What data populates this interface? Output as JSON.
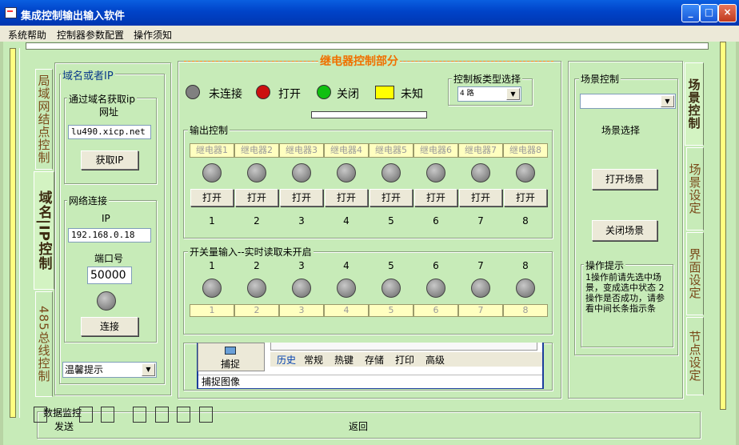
{
  "window": {
    "title": "集成控制输出输入软件",
    "min_label": "_",
    "max_label": "□",
    "close_label": "×"
  },
  "menu": [
    "系统帮助",
    "控制器参数配置",
    "操作须知"
  ],
  "left_tabs": [
    "局域网结点控制",
    "域名|IP控制",
    "485总线控制"
  ],
  "right_tabs": [
    "场景控制",
    "场景设定",
    "界面设定",
    "节点设定"
  ],
  "domain_panel": {
    "title": "域名或者IP",
    "domain_group": "通过域名获取ip",
    "url_label": "网址",
    "url_value": "lu490.xicp.net",
    "get_ip_button": "获取IP",
    "network_group": "网络连接",
    "ip_label": "IP",
    "ip_value": "192.168.0.18",
    "port_label": "端口号",
    "port_value": "50000",
    "connect_button": "连接",
    "hint_combo": "温馨提示"
  },
  "relay": {
    "title": "继电器控制部分",
    "status_legend": [
      {
        "label": "未连接",
        "color": "#808080"
      },
      {
        "label": "打开",
        "color": "#cc1010"
      },
      {
        "label": "关闭",
        "color": "#10c010"
      },
      {
        "label": "未知",
        "color": "#ffff00"
      }
    ],
    "board_type_label": "控制板类型选择",
    "board_type_value": "4 路",
    "output_title": "输出控制",
    "relays": [
      "继电器1",
      "继电器2",
      "继电器3",
      "继电器4",
      "继电器5",
      "继电器6",
      "继电器7",
      "继电器8"
    ],
    "open_label": "打开",
    "numbers": [
      "1",
      "2",
      "3",
      "4",
      "5",
      "6",
      "7",
      "8"
    ],
    "input_title": "开关量输入--实时读取未开启",
    "input_cells": [
      "1",
      "2",
      "3",
      "4",
      "5",
      "6",
      "7",
      "8"
    ]
  },
  "overlay": {
    "capture_label": "捕捉",
    "tabs": [
      "历史",
      "常规",
      "热键",
      "存储",
      "打印",
      "高级"
    ],
    "status": "捕捉图像"
  },
  "scene": {
    "title": "场景控制",
    "select_label": "场景选择",
    "open_button": "打开场景",
    "close_button": "关闭场景",
    "tips_title": "操作提示",
    "tips_text": "1操作前请先选中场景，变成选中状态 2操作是否成功，请参看中间长条指示条"
  },
  "bottom": {
    "data_label": "数据监控",
    "send_label": "发送",
    "return_label": "返回"
  }
}
